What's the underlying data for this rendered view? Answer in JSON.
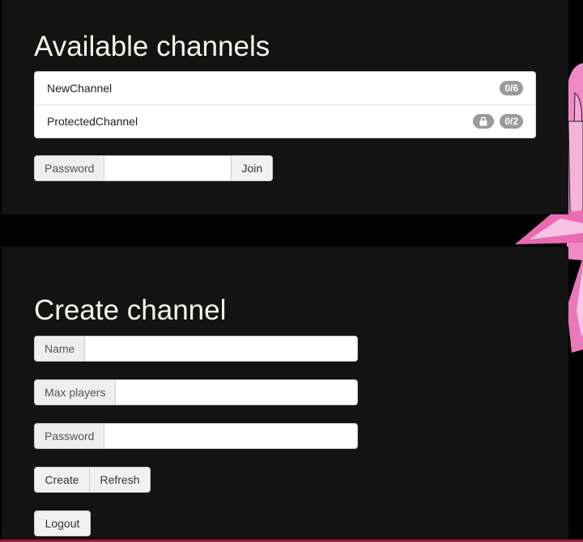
{
  "available": {
    "title": "Available channels",
    "channels": [
      {
        "name": "NewChannel",
        "players": "0/6",
        "protected": false
      },
      {
        "name": "ProtectedChannel",
        "players": "0/2",
        "protected": true
      }
    ],
    "password_label": "Password",
    "password_value": "",
    "join_label": "Join"
  },
  "create": {
    "title": "Create channel",
    "name_label": "Name",
    "name_value": "",
    "max_players_label": "Max players",
    "max_players_value": "",
    "password_label": "Password",
    "password_value": "",
    "create_label": "Create",
    "refresh_label": "Refresh",
    "logout_label": "Logout"
  },
  "icons": {
    "lock": "lock-icon"
  },
  "colors": {
    "panel": "#131313",
    "page_background": "#020202",
    "title_text": "#f2f7ec",
    "badge": "#9a9a9a",
    "background_art": "#f089c6",
    "bottom_line": "#a11a40"
  }
}
